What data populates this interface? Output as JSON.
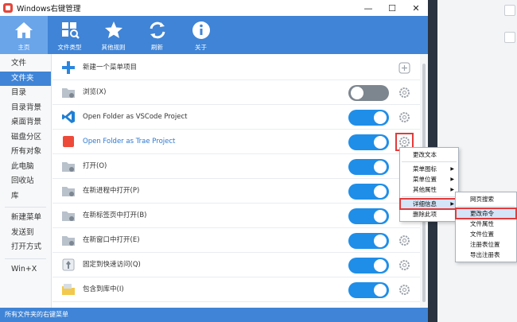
{
  "window": {
    "title": "Windows右键管理",
    "controls": {
      "minimize": "—",
      "maximize": "☐",
      "close": "✕"
    }
  },
  "toolbar": {
    "items": [
      {
        "label": "主页",
        "icon": "home-icon",
        "active": true
      },
      {
        "label": "文件类型",
        "icon": "file-search-icon",
        "active": false
      },
      {
        "label": "其他规则",
        "icon": "star-icon",
        "active": false
      },
      {
        "label": "刷新",
        "icon": "refresh-icon",
        "active": false
      },
      {
        "label": "关于",
        "icon": "info-icon",
        "active": false
      }
    ]
  },
  "sidebar": {
    "group1": [
      "文件",
      "文件夹",
      "目录",
      "目录背景",
      "桌面背景",
      "磁盘分区",
      "所有对象",
      "此电脑",
      "回收站",
      "库"
    ],
    "group2": [
      "新建菜单",
      "发送到",
      "打开方式"
    ],
    "group3": [
      "Win+X"
    ],
    "active": "文件夹"
  },
  "rows": [
    {
      "label": "新建一个菜单项目",
      "icon": "plus-icon",
      "toggle": null
    },
    {
      "label": "浏览(X)",
      "icon": "folder-gear-icon",
      "toggle": "off"
    },
    {
      "label": "Open Folder as VSCode Project",
      "icon": "vscode-icon",
      "toggle": "on"
    },
    {
      "label": "Open Folder as Trae Project",
      "icon": "trae-icon",
      "toggle": "on",
      "highlight": true
    },
    {
      "label": "打开(O)",
      "icon": "folder-gear-icon",
      "toggle": "on"
    },
    {
      "label": "在新进程中打开(P)",
      "icon": "folder-gear-icon",
      "toggle": "on"
    },
    {
      "label": "在新标签页中打开(B)",
      "icon": "folder-gear-icon",
      "toggle": "on"
    },
    {
      "label": "在新窗口中打开(E)",
      "icon": "folder-gear-icon",
      "toggle": "on"
    },
    {
      "label": "固定到快速访问(Q)",
      "icon": "pin-icon",
      "toggle": "on"
    },
    {
      "label": "包含到库中(I)",
      "icon": "library-icon",
      "toggle": "on"
    }
  ],
  "context_menu": {
    "items": [
      {
        "label": "更改文本",
        "submenu": false
      },
      {
        "sep": true
      },
      {
        "label": "菜单图标",
        "submenu": true
      },
      {
        "label": "菜单位置",
        "submenu": true
      },
      {
        "label": "其他属性",
        "submenu": true
      },
      {
        "sep": true
      },
      {
        "label": "详细信息",
        "submenu": true,
        "selected": true
      },
      {
        "label": "删除此项",
        "submenu": false
      }
    ]
  },
  "sub_menu": {
    "items": [
      {
        "label": "网页搜索"
      },
      {
        "sep": true
      },
      {
        "label": "更改命令",
        "selected": true
      },
      {
        "label": "文件属性"
      },
      {
        "label": "文件位置"
      },
      {
        "label": "注册表位置"
      },
      {
        "label": "导出注册表"
      }
    ]
  },
  "status": {
    "text": "所有文件夹的右键菜单"
  },
  "colors": {
    "accent": "#3f84d6",
    "toggle_on": "#1f8ee8",
    "toggle_off": "#7d868f",
    "highlight_box": "#e23b3b"
  }
}
